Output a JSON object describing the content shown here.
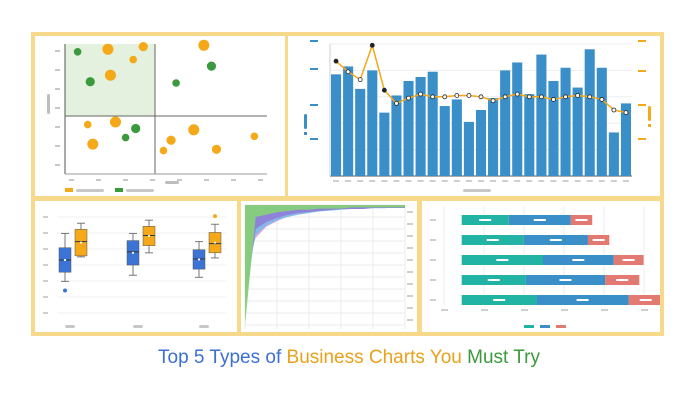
{
  "headline": {
    "part1": "Top 5 Types of ",
    "part2": "Business Charts ",
    "part3": "You ",
    "part4": "Must Try",
    "colors": [
      "#3b6fd1",
      "#e8a11a",
      "#e8a11a",
      "#3a9a3d"
    ]
  },
  "palette": {
    "frame": "#f7d98b",
    "blue": "#2f8bd2",
    "bar_blue": "#3a8fc9",
    "orange": "#f5a818",
    "green": "#3a9a3d",
    "box_blue": "#3c74d6",
    "teal": "#21b3a3",
    "salmon": "#e37a72",
    "grey": "#b4b4b4"
  },
  "chart_data": [
    {
      "type": "scatter",
      "quadrant": true,
      "x": [
        1,
        2,
        3,
        4,
        5,
        6,
        7,
        8,
        9,
        10,
        11,
        12,
        13,
        14,
        15,
        16,
        17,
        18
      ],
      "points": [
        {
          "x": 0.5,
          "y": 9.4,
          "series": "green"
        },
        {
          "x": 1.7,
          "y": 9.6,
          "series": "orange"
        },
        {
          "x": 3.1,
          "y": 9.8,
          "series": "orange"
        },
        {
          "x": 2.7,
          "y": 8.8,
          "series": "orange"
        },
        {
          "x": 1.8,
          "y": 7.6,
          "series": "orange"
        },
        {
          "x": 1.0,
          "y": 7.1,
          "series": "green"
        },
        {
          "x": 4.4,
          "y": 7.0,
          "series": "green"
        },
        {
          "x": 5.5,
          "y": 9.9,
          "series": "orange"
        },
        {
          "x": 5.8,
          "y": 8.3,
          "series": "green"
        },
        {
          "x": 0.9,
          "y": 3.8,
          "series": "orange"
        },
        {
          "x": 2.0,
          "y": 4.0,
          "series": "orange"
        },
        {
          "x": 2.8,
          "y": 3.5,
          "series": "green"
        },
        {
          "x": 2.4,
          "y": 2.8,
          "series": "green"
        },
        {
          "x": 1.1,
          "y": 2.3,
          "series": "orange"
        },
        {
          "x": 4.2,
          "y": 2.6,
          "series": "orange"
        },
        {
          "x": 3.9,
          "y": 1.8,
          "series": "orange"
        },
        {
          "x": 5.1,
          "y": 3.4,
          "series": "orange"
        },
        {
          "x": 6.0,
          "y": 1.9,
          "series": "orange"
        },
        {
          "x": 7.5,
          "y": 2.9,
          "series": "orange"
        }
      ],
      "xlim": [
        0,
        8
      ],
      "ylim": [
        0,
        10
      ]
    },
    {
      "type": "bar",
      "values": [
        77,
        83,
        66,
        80,
        48,
        61,
        72,
        75,
        79,
        53,
        58,
        41,
        50,
        59,
        80,
        86,
        62,
        92,
        72,
        82,
        67,
        96,
        82,
        33,
        55
      ],
      "line_values": [
        87,
        79,
        73,
        99,
        65,
        55,
        59,
        62,
        60,
        60,
        61,
        61,
        60,
        57,
        60,
        62,
        60,
        60,
        58,
        60,
        61,
        60,
        58,
        50,
        48
      ],
      "ylim": [
        0,
        100
      ]
    },
    {
      "type": "box",
      "groups": [
        {
          "series": [
            {
              "min": 31,
              "q1": 40,
              "median": 52,
              "q3": 64,
              "max": 78,
              "color": "blue",
              "outliers": [
                22
              ]
            },
            {
              "min": 55,
              "q1": 56,
              "median": 70,
              "q3": 82,
              "max": 88,
              "color": "orange",
              "outliers": []
            }
          ]
        },
        {
          "series": [
            {
              "min": 37,
              "q1": 47,
              "median": 60,
              "q3": 71,
              "max": 78,
              "color": "blue",
              "outliers": []
            },
            {
              "min": 59,
              "q1": 66,
              "median": 76,
              "q3": 85,
              "max": 91,
              "color": "orange",
              "outliers": []
            }
          ]
        },
        {
          "series": [
            {
              "min": 35,
              "q1": 43,
              "median": 53,
              "q3": 62,
              "max": 70,
              "color": "blue",
              "outliers": []
            },
            {
              "min": 54,
              "q1": 59,
              "median": 68,
              "q3": 79,
              "max": 87,
              "color": "orange",
              "outliers": [
                95
              ]
            }
          ]
        }
      ],
      "ylim": [
        0,
        100
      ]
    },
    {
      "type": "area",
      "layers": [
        {
          "color": "#f7b252",
          "values": [
            100,
            96,
            62,
            40,
            27,
            20,
            16,
            13,
            11,
            9,
            8,
            7,
            6,
            5,
            5,
            4
          ]
        },
        {
          "color": "#f07a5c",
          "values": [
            100,
            76,
            50,
            34,
            24,
            18,
            14,
            11,
            10,
            8,
            7,
            6,
            5,
            5,
            4,
            4
          ]
        },
        {
          "color": "#e9a0d8",
          "values": [
            100,
            55,
            36,
            27,
            19,
            15,
            12,
            10,
            8,
            7,
            6,
            5,
            5,
            4,
            4,
            3
          ]
        },
        {
          "color": "#7fb9e8",
          "values": [
            100,
            38,
            26,
            19,
            15,
            12,
            10,
            8,
            7,
            6,
            5,
            5,
            4,
            4,
            3,
            3
          ]
        },
        {
          "color": "#8f7ed8",
          "values": [
            100,
            24,
            17,
            13,
            10,
            8,
            7,
            6,
            5,
            4,
            4,
            4,
            3,
            3,
            3,
            3
          ]
        },
        {
          "color": "#86cf7a",
          "values": [
            100,
            10,
            8,
            6,
            5,
            4,
            4,
            3,
            3,
            3,
            2,
            2,
            2,
            2,
            2,
            2
          ]
        }
      ]
    },
    {
      "type": "bar",
      "orientation": "horizontal-stacked",
      "rows": [
        [
          22,
          29,
          10
        ],
        [
          29,
          30,
          10
        ],
        [
          38,
          33,
          14
        ],
        [
          30,
          37,
          16
        ],
        [
          35,
          43,
          16
        ]
      ],
      "segment_colors": [
        "teal",
        "blue",
        "salmon"
      ],
      "xlim": [
        0,
        100
      ]
    }
  ]
}
